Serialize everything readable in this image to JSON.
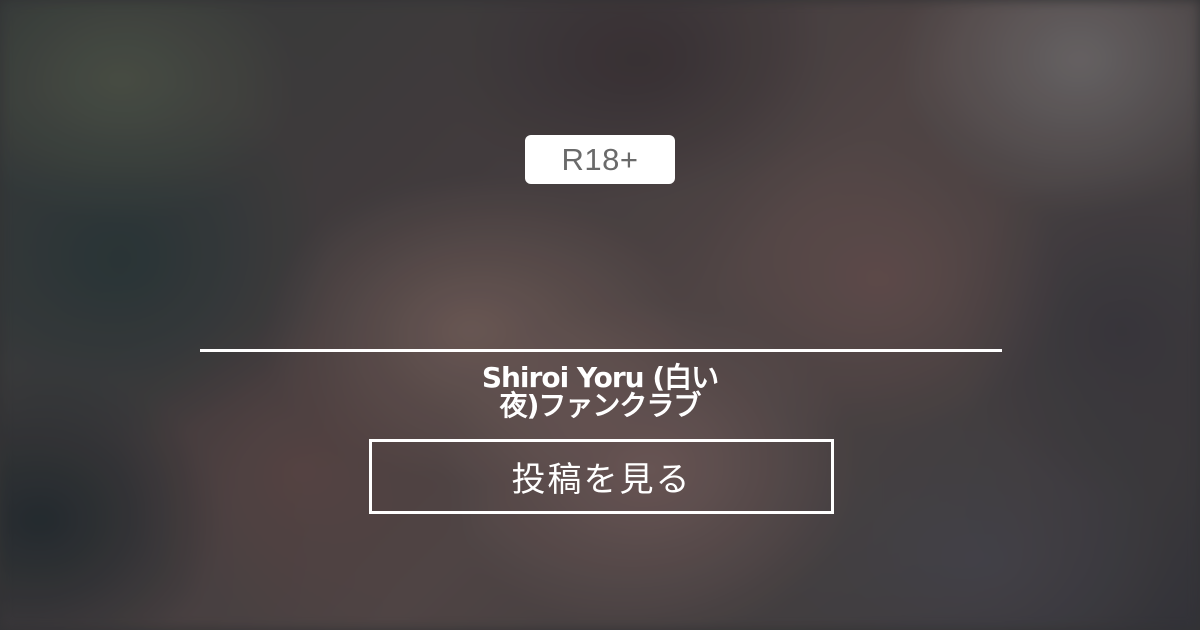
{
  "badge": {
    "label": "R18+"
  },
  "club": {
    "title_line1": "Shiroi Yoru (白い",
    "title_line2": "夜)ファンクラブ"
  },
  "cta": {
    "label": "投稿を見る"
  },
  "colors": {
    "badge_bg": "#ffffff",
    "badge_text": "#6a6a6a",
    "foreground": "#ffffff"
  }
}
